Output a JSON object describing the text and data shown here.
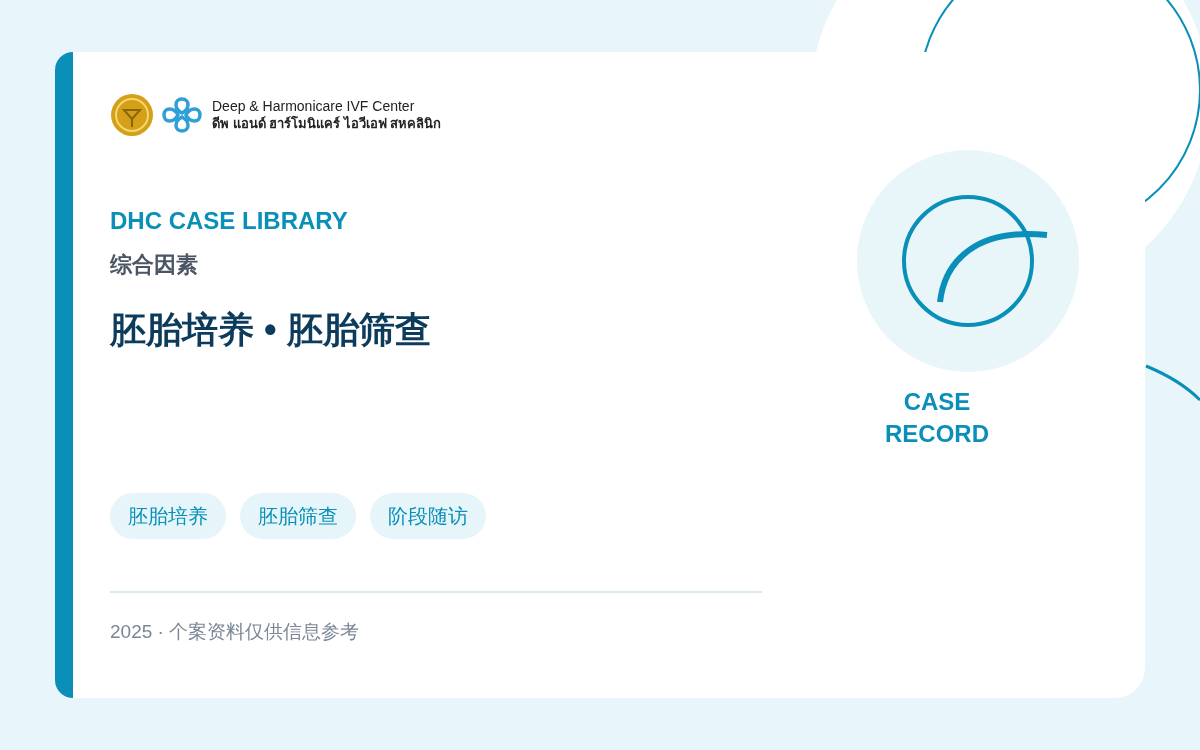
{
  "logo": {
    "name": "Deep & Harmonicare IVF Center",
    "name_thai": "ดีพ แอนด์ ฮาร์โมนิแคร์ ไอวีเอฟ สหคลินิก"
  },
  "eyebrow": "DHC CASE LIBRARY",
  "category": "综合因素",
  "title": "胚胎培养 • 胚胎筛查",
  "tags": [
    "胚胎培养",
    "胚胎筛查",
    "阶段随访"
  ],
  "footer": "2025 · 个案资料仅供信息参考",
  "badge": {
    "text": "CASE RECORD"
  }
}
